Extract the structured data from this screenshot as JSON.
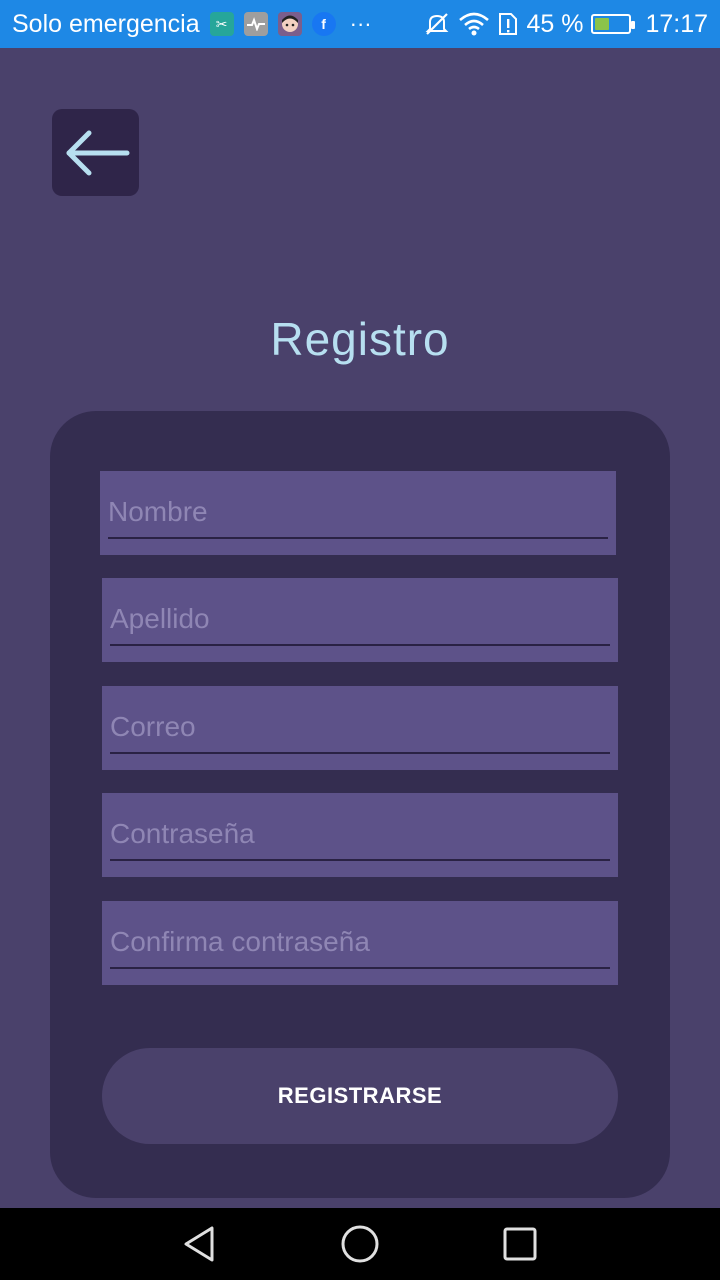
{
  "status_bar": {
    "carrier": "Solo emergencia",
    "overflow": "···",
    "battery_text": "45 %",
    "battery_level": 0.45,
    "time": "17:17",
    "notification_icons": [
      "scissors-app-icon",
      "health-app-icon",
      "avatar-app-icon",
      "facebook-icon"
    ],
    "system_icons": [
      "mute-icon",
      "wifi-icon",
      "sim-alert-icon",
      "battery-icon"
    ]
  },
  "header": {
    "back_icon": "arrow-left-icon",
    "title": "Registro"
  },
  "form": {
    "fields": [
      {
        "name": "nombre",
        "placeholder": "Nombre",
        "value": ""
      },
      {
        "name": "apellido",
        "placeholder": "Apellido",
        "value": ""
      },
      {
        "name": "correo",
        "placeholder": "Correo",
        "value": ""
      },
      {
        "name": "contrasena",
        "placeholder": "Contraseña",
        "value": ""
      },
      {
        "name": "confirma",
        "placeholder": "Confirma contraseña",
        "value": ""
      }
    ],
    "submit_label": "REGISTRARSE"
  },
  "navigation": {
    "buttons": [
      "back-triangle-icon",
      "home-circle-icon",
      "recents-square-icon"
    ]
  },
  "colors": {
    "status_bar": "#1e88e5",
    "background": "#4a416b",
    "card": "#342d50",
    "field": "#5d5289",
    "title": "#b7dff0",
    "back_button": "#2f2549"
  }
}
